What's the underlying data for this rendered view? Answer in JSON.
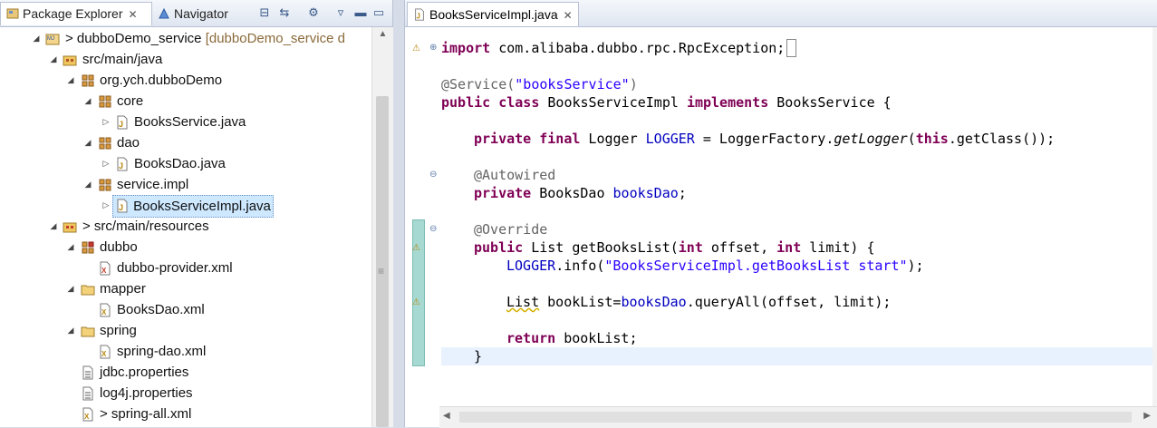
{
  "left_panel": {
    "tabs": [
      {
        "label": "Package Explorer",
        "icon": "package-explorer-icon"
      },
      {
        "label": "Navigator",
        "icon": "navigator-icon"
      }
    ],
    "tree": [
      {
        "label": "> dubboDemo_service",
        "suffix": "[dubboDemo_service d",
        "icon": "maven-project-icon",
        "expanded": true
      },
      {
        "label": "src/main/java",
        "icon": "source-folder-icon",
        "expanded": true
      },
      {
        "label": "org.ych.dubboDemo",
        "icon": "package-icon",
        "expanded": true
      },
      {
        "label": "core",
        "icon": "package-icon",
        "expanded": true
      },
      {
        "label": "BooksService.java",
        "icon": "java-file-icon",
        "expanded": false
      },
      {
        "label": "dao",
        "icon": "package-icon",
        "expanded": true
      },
      {
        "label": "BooksDao.java",
        "icon": "java-file-icon",
        "expanded": false
      },
      {
        "label": "service.impl",
        "icon": "package-icon",
        "expanded": true
      },
      {
        "label": "BooksServiceImpl.java",
        "icon": "java-file-icon",
        "expanded": false
      },
      {
        "label": "> src/main/resources",
        "icon": "resource-folder-icon",
        "expanded": true
      },
      {
        "label": "dubbo",
        "icon": "package-icon",
        "expanded": true
      },
      {
        "label": "dubbo-provider.xml",
        "icon": "xml-file-icon"
      },
      {
        "label": "mapper",
        "icon": "folder-icon",
        "expanded": true
      },
      {
        "label": "BooksDao.xml",
        "icon": "xml-file-icon"
      },
      {
        "label": "spring",
        "icon": "folder-icon",
        "expanded": true
      },
      {
        "label": "spring-dao.xml",
        "icon": "xml-file-icon"
      },
      {
        "label": "jdbc.properties",
        "icon": "properties-file-icon"
      },
      {
        "label": "log4j.properties",
        "icon": "properties-file-icon"
      },
      {
        "label": "> spring-all.xml",
        "icon": "xml-file-icon"
      }
    ]
  },
  "editor": {
    "tab_label": "BooksServiceImpl.java",
    "code": {
      "l1_kw": "import",
      "l1_rest": " com.alibaba.dubbo.rpc.RpcException;",
      "l2_ann": "@Service(",
      "l2_str": "\"booksService\"",
      "l2_end": ")",
      "l3_kw1": "public class",
      "l3_mid": " BooksServiceImpl ",
      "l3_kw2": "implements",
      "l3_end": " BooksService {",
      "l4_kw": "private final",
      "l4_a": " Logger ",
      "l4_fld": "LOGGER",
      "l4_b": " = LoggerFactory.",
      "l4_it": "getLogger",
      "l4_c": "(",
      "l4_kw2": "this",
      "l4_d": ".getClass());",
      "l5_ann": "@Autowired",
      "l6_kw": "private",
      "l6_a": " BooksDao ",
      "l6_fld": "booksDao",
      "l6_end": ";",
      "l7_ann": "@Override",
      "l8_kw": "public",
      "l8_a": " List getBooksList(",
      "l8_kw2": "int",
      "l8_b": " offset, ",
      "l8_kw3": "int",
      "l8_c": " limit) {",
      "l9_fld": "LOGGER",
      "l9_a": ".info(",
      "l9_str": "\"BooksServiceImpl.getBooksList start\"",
      "l9_end": ");",
      "l10_a": "List",
      "l10_b": " bookList=",
      "l10_fld": "booksDao",
      "l10_c": ".queryAll(offset, limit);",
      "l11_kw": "return",
      "l11_a": " bookList;",
      "l12": "}"
    }
  }
}
